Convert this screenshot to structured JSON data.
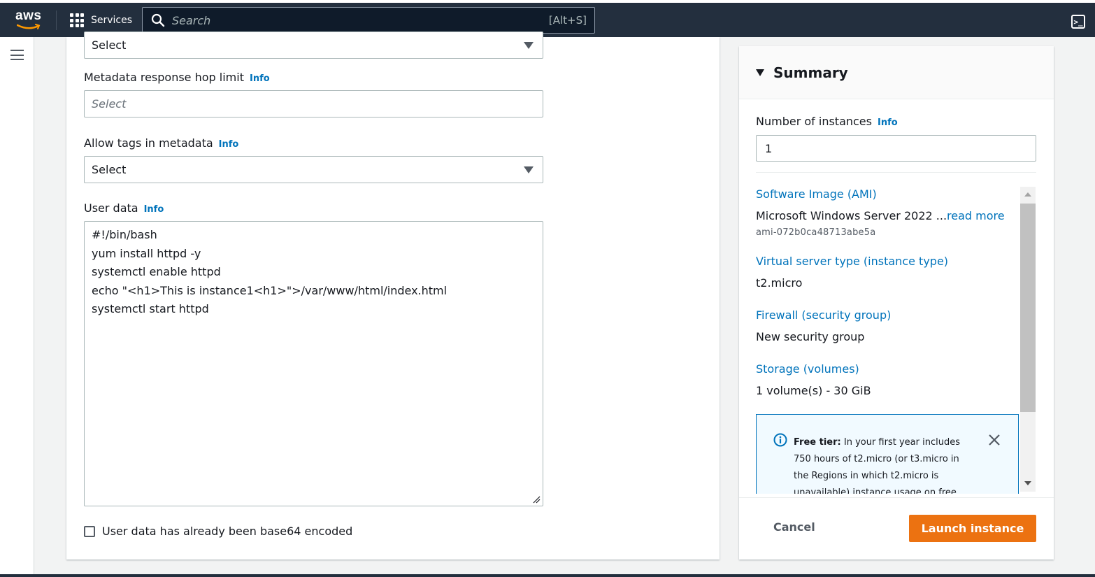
{
  "nav": {
    "logo_text": "aws",
    "services_label": "Services",
    "search_placeholder": "Search",
    "search_shortcut": "[Alt+S]",
    "brand_color": "#232f3e"
  },
  "main": {
    "top_select": {
      "value": "Select"
    },
    "hop_limit": {
      "label": "Metadata response hop limit",
      "info": "Info",
      "placeholder": "Select"
    },
    "allow_tags": {
      "label": "Allow tags in metadata",
      "info": "Info",
      "value": "Select"
    },
    "user_data": {
      "label": "User data",
      "info": "Info",
      "lines": [
        "#!/bin/bash",
        "yum install httpd -y",
        "systemctl enable httpd",
        "echo \"<h1>This is instance1<h1>\">/var/www/html/index.html",
        "systemctl start httpd"
      ]
    },
    "base64_checkbox": {
      "label": "User data has already been base64 encoded",
      "checked": false
    }
  },
  "summary": {
    "title": "Summary",
    "num_instances": {
      "label": "Number of instances",
      "info": "Info",
      "value": "1"
    },
    "ami": {
      "label": "Software Image (AMI)",
      "value": "Microsoft Windows Server 2022 ...",
      "read_more": "read more",
      "id": "ami-072b0ca48713abe5a"
    },
    "instance_type": {
      "label": "Virtual server type (instance type)",
      "value": "t2.micro"
    },
    "firewall": {
      "label": "Firewall (security group)",
      "value": "New security group"
    },
    "storage": {
      "label": "Storage (volumes)",
      "value": "1 volume(s) - 30 GiB"
    },
    "free_tier": {
      "bold": "Free tier:",
      "line1": "In your first year includes",
      "line2": "750 hours of t2.micro (or t3.micro in",
      "line3": "the Regions in which t2.micro is",
      "line4": "unavailable) instance usage on free tier"
    },
    "cancel_label": "Cancel",
    "launch_label": "Launch instance",
    "launch_color": "#ec7211",
    "link_color": "#0073bb"
  }
}
